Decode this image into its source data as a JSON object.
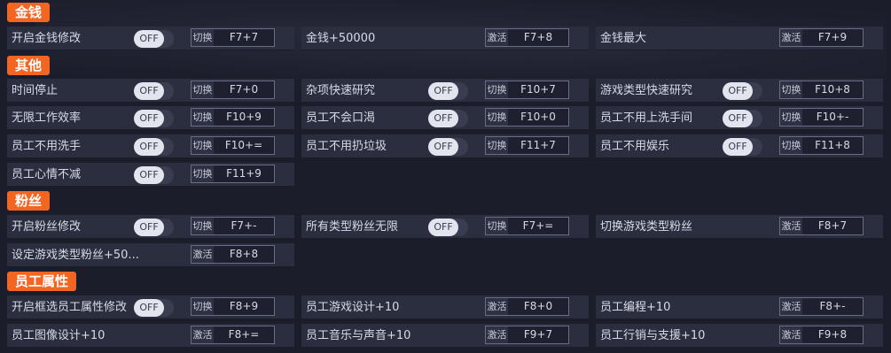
{
  "toggle_text": "OFF",
  "sections": {
    "money": "金钱",
    "other": "其他",
    "fans": "粉丝",
    "staff": "员工属性"
  },
  "rows": [
    {
      "label": "开启金钱修改",
      "action": "切换",
      "key": "F7+7"
    },
    {
      "label": "金钱+50000",
      "action": "激活",
      "key": "F7+8"
    },
    {
      "label": "金钱最大",
      "action": "激活",
      "key": "F7+9"
    },
    {
      "label": "时间停止",
      "action": "切换",
      "key": "F7+0"
    },
    {
      "label": "杂项快速研究",
      "action": "切换",
      "key": "F10+7"
    },
    {
      "label": "游戏类型快速研究",
      "action": "切换",
      "key": "F10+8"
    },
    {
      "label": "无限工作效率",
      "action": "切换",
      "key": "F10+9"
    },
    {
      "label": "员工不会口渴",
      "action": "切换",
      "key": "F10+0"
    },
    {
      "label": "员工不用上洗手间",
      "action": "切换",
      "key": "F10+-"
    },
    {
      "label": "员工不用洗手",
      "action": "切换",
      "key": "F10+="
    },
    {
      "label": "员工不用扔垃圾",
      "action": "切换",
      "key": "F11+7"
    },
    {
      "label": "员工不用娱乐",
      "action": "切换",
      "key": "F11+8"
    },
    {
      "label": "员工心情不减",
      "action": "切换",
      "key": "F11+9"
    },
    {
      "label": "开启粉丝修改",
      "action": "切换",
      "key": "F7+-"
    },
    {
      "label": "所有类型粉丝无限",
      "action": "切换",
      "key": "F7+="
    },
    {
      "label": "切换游戏类型粉丝",
      "action": "激活",
      "key": "F8+7"
    },
    {
      "label": "设定游戏类型粉丝+50...",
      "action": "激活",
      "key": "F8+8"
    },
    {
      "label": "开启框选员工属性修改",
      "action": "切换",
      "key": "F8+9"
    },
    {
      "label": "员工游戏设计+10",
      "action": "激活",
      "key": "F8+0"
    },
    {
      "label": "员工编程+10",
      "action": "激活",
      "key": "F8+-"
    },
    {
      "label": "员工图像设计+10",
      "action": "激活",
      "key": "F8+="
    },
    {
      "label": "员工音乐与声音+10",
      "action": "激活",
      "key": "F9+7"
    },
    {
      "label": "员工行销与支援+10",
      "action": "激活",
      "key": "F9+8"
    }
  ]
}
